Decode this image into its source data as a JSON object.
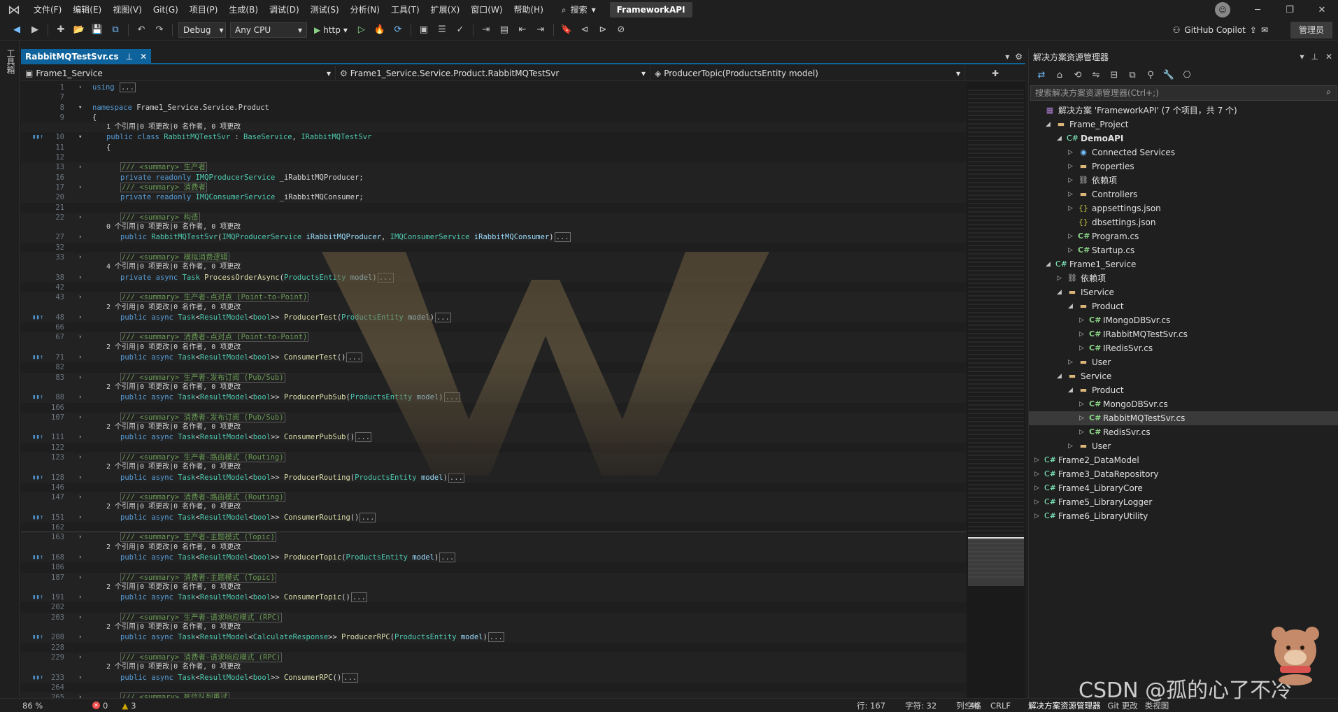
{
  "menubar": {
    "items": [
      "文件(F)",
      "编辑(E)",
      "视图(V)",
      "Git(G)",
      "项目(P)",
      "生成(B)",
      "调试(D)",
      "测试(S)",
      "分析(N)",
      "工具(T)",
      "扩展(X)",
      "窗口(W)",
      "帮助(H)"
    ],
    "search_label": "搜索",
    "solution_name": "FrameworkAPI"
  },
  "toolbar": {
    "config": "Debug",
    "platform": "Any CPU",
    "run_target": "http",
    "copilot": "GitHub Copilot",
    "admin": "管理员"
  },
  "toolbox": {
    "label": "工具箱"
  },
  "editor": {
    "tab_name": "RabbitMQTestSvr.cs",
    "nav_project": "Frame1_Service",
    "nav_class": "Frame1_Service.Service.Product.RabbitMQTestSvr",
    "nav_member": "ProducerTopic(ProductsEntity model)"
  },
  "code": {
    "lines": [
      {
        "ln": "1",
        "kind": "using",
        "text": "using"
      },
      {
        "ln": "7",
        "kind": "blank"
      },
      {
        "ln": "8",
        "kind": "namespace",
        "text": "namespace Frame1_Service.Service.Product"
      },
      {
        "ln": "9",
        "kind": "plain",
        "text": "{"
      },
      {
        "kind": "lens",
        "text": "1 个引用|0 项更改|0 名作者, 0 项更改"
      },
      {
        "ln": "10",
        "kind": "classdecl",
        "text": "public class RabbitMQTestSvr : BaseService, IRabbitMQTestSvr"
      },
      {
        "ln": "11",
        "kind": "plain",
        "text": "{"
      },
      {
        "ln": "12",
        "kind": "blank"
      },
      {
        "ln": "13",
        "kind": "summary",
        "text": "/// <summary> 生产者"
      },
      {
        "ln": "16",
        "kind": "field",
        "text": "private readonly IMQProducerService _iRabbitMQProducer;"
      },
      {
        "ln": "17",
        "kind": "summary",
        "text": "/// <summary> 消费者"
      },
      {
        "ln": "20",
        "kind": "field",
        "text": "private readonly IMQConsumerService _iRabbitMQConsumer;"
      },
      {
        "ln": "21",
        "kind": "blank"
      },
      {
        "ln": "22",
        "kind": "summary",
        "text": "/// <summary> 构造"
      },
      {
        "kind": "lens",
        "text": "0 个引用|0 项更改|0 名作者, 0 项更改"
      },
      {
        "ln": "27",
        "kind": "ctor",
        "text": "public RabbitMQTestSvr(IMQProducerService iRabbitMQProducer, IMQConsumerService iRabbitMQConsumer)"
      },
      {
        "ln": "32",
        "kind": "blank"
      },
      {
        "ln": "33",
        "kind": "summary",
        "text": "/// <summary> 模拟消费逻辑"
      },
      {
        "kind": "lens",
        "text": "4 个引用|0 项更改|0 名作者, 0 项更改"
      },
      {
        "ln": "38",
        "kind": "method",
        "text": "private async Task ProcessOrderAsync(ProductsEntity model)"
      },
      {
        "ln": "42",
        "kind": "blank"
      },
      {
        "ln": "43",
        "kind": "summary",
        "text": "/// <summary> 生产者-点对点 (Point-to-Point)"
      },
      {
        "kind": "lens",
        "text": "2 个引用|0 项更改|0 名作者, 0 项更改"
      },
      {
        "ln": "48",
        "kind": "method",
        "text": "public async Task<ResultModel<bool>> ProducerTest(ProductsEntity model)"
      },
      {
        "ln": "66",
        "kind": "blank"
      },
      {
        "ln": "67",
        "kind": "summary",
        "text": "/// <summary> 消费者-点对点 (Point-to-Point)"
      },
      {
        "kind": "lens",
        "text": "2 个引用|0 项更改|0 名作者, 0 项更改"
      },
      {
        "ln": "71",
        "kind": "method",
        "text": "public async Task<ResultModel<bool>> ConsumerTest()"
      },
      {
        "ln": "82",
        "kind": "blank"
      },
      {
        "ln": "83",
        "kind": "summary",
        "text": "/// <summary> 生产者-发布订阅 (Pub/Sub)"
      },
      {
        "kind": "lens",
        "text": "2 个引用|0 项更改|0 名作者, 0 项更改"
      },
      {
        "ln": "88",
        "kind": "method",
        "text": "public async Task<ResultModel<bool>> ProducerPubSub(ProductsEntity model)"
      },
      {
        "ln": "106",
        "kind": "blank"
      },
      {
        "ln": "107",
        "kind": "summary",
        "text": "/// <summary> 消费者-发布订阅 (Pub/Sub)"
      },
      {
        "kind": "lens",
        "text": "2 个引用|0 项更改|0 名作者, 0 项更改"
      },
      {
        "ln": "111",
        "kind": "method",
        "text": "public async Task<ResultModel<bool>> ConsumerPubSub()"
      },
      {
        "ln": "122",
        "kind": "blank"
      },
      {
        "ln": "123",
        "kind": "summary",
        "text": "/// <summary> 生产者-路由模式 (Routing)"
      },
      {
        "kind": "lens",
        "text": "2 个引用|0 项更改|0 名作者, 0 项更改"
      },
      {
        "ln": "128",
        "kind": "method",
        "text": "public async Task<ResultModel<bool>> ProducerRouting(ProductsEntity model)"
      },
      {
        "ln": "146",
        "kind": "blank"
      },
      {
        "ln": "147",
        "kind": "summary",
        "text": "/// <summary> 消费者-路由模式 (Routing)"
      },
      {
        "kind": "lens",
        "text": "2 个引用|0 项更改|0 名作者, 0 项更改"
      },
      {
        "ln": "151",
        "kind": "method",
        "text": "public async Task<ResultModel<bool>> ConsumerRouting()"
      },
      {
        "ln": "162",
        "kind": "blank"
      },
      {
        "ln": "163",
        "kind": "summary",
        "text": "/// <summary> 生产者-主题模式 (Topic)",
        "current": true
      },
      {
        "kind": "lens",
        "text": "2 个引用|0 项更改|0 名作者, 0 项更改"
      },
      {
        "ln": "168",
        "kind": "method",
        "text": "public async Task<ResultModel<bool>> ProducerTopic(ProductsEntity model)"
      },
      {
        "ln": "186",
        "kind": "blank"
      },
      {
        "ln": "187",
        "kind": "summary",
        "text": "/// <summary> 消费者-主题模式 (Topic)"
      },
      {
        "kind": "lens",
        "text": "2 个引用|0 项更改|0 名作者, 0 项更改"
      },
      {
        "ln": "191",
        "kind": "method",
        "text": "public async Task<ResultModel<bool>> ConsumerTopic()"
      },
      {
        "ln": "202",
        "kind": "blank"
      },
      {
        "ln": "203",
        "kind": "summary",
        "text": "/// <summary> 生产者-请求响应模式 (RPC)"
      },
      {
        "kind": "lens",
        "text": "2 个引用|0 项更改|0 名作者, 0 项更改"
      },
      {
        "ln": "208",
        "kind": "method",
        "text": "public async Task<ResultModel<CalculateResponse>> ProducerRPC(ProductsEntity model)"
      },
      {
        "ln": "228",
        "kind": "blank"
      },
      {
        "ln": "229",
        "kind": "summary",
        "text": "/// <summary> 消费者-请求响应模式 (RPC)"
      },
      {
        "kind": "lens",
        "text": "2 个引用|0 项更改|0 名作者, 0 项更改"
      },
      {
        "ln": "233",
        "kind": "method",
        "text": "public async Task<ResultModel<bool>> ConsumerRPC()"
      },
      {
        "ln": "264",
        "kind": "blank"
      },
      {
        "ln": "265",
        "kind": "summary",
        "text": "/// <summary> 死信队列重试"
      }
    ]
  },
  "statusbar": {
    "zoom": "86 %",
    "errors": "0",
    "warnings": "3",
    "line": "行: 167",
    "char": "字符: 32",
    "col": "列: 46",
    "indent": "空格",
    "eol": "CRLF",
    "bottom_tabs": [
      "解决方案资源管理器",
      "Git 更改",
      "类视图"
    ]
  },
  "solution_explorer": {
    "title": "解决方案资源管理器",
    "search_placeholder": "搜索解决方案资源管理器(Ctrl+;)",
    "tree": [
      {
        "label": "解决方案 'FrameworkAPI' (7 个项目，共 7 个)",
        "indent": 0,
        "arrow": "",
        "icon": "solution"
      },
      {
        "label": "Frame_Project",
        "indent": 1,
        "arrow": "open",
        "icon": "folder"
      },
      {
        "label": "DemoAPI",
        "indent": 2,
        "arrow": "open",
        "icon": "project",
        "bold": true
      },
      {
        "label": "Connected Services",
        "indent": 3,
        "arrow": "closed",
        "icon": "service"
      },
      {
        "label": "Properties",
        "indent": 3,
        "arrow": "closed",
        "icon": "folder"
      },
      {
        "label": "依赖项",
        "indent": 3,
        "arrow": "closed",
        "icon": "ref"
      },
      {
        "label": "Controllers",
        "indent": 3,
        "arrow": "closed",
        "icon": "folder"
      },
      {
        "label": "appsettings.json",
        "indent": 3,
        "arrow": "closed",
        "icon": "json"
      },
      {
        "label": "dbsettings.json",
        "indent": 3,
        "arrow": "",
        "icon": "json"
      },
      {
        "label": "Program.cs",
        "indent": 3,
        "arrow": "closed",
        "icon": "cs"
      },
      {
        "label": "Startup.cs",
        "indent": 3,
        "arrow": "closed",
        "icon": "cs"
      },
      {
        "label": "Frame1_Service",
        "indent": 1,
        "arrow": "open",
        "icon": "project"
      },
      {
        "label": "依赖项",
        "indent": 2,
        "arrow": "closed",
        "icon": "ref"
      },
      {
        "label": "IService",
        "indent": 2,
        "arrow": "open",
        "icon": "folder"
      },
      {
        "label": "Product",
        "indent": 3,
        "arrow": "open",
        "icon": "folder"
      },
      {
        "label": "IMongoDBSvr.cs",
        "indent": 4,
        "arrow": "closed",
        "icon": "cs"
      },
      {
        "label": "IRabbitMQTestSvr.cs",
        "indent": 4,
        "arrow": "closed",
        "icon": "cs"
      },
      {
        "label": "IRedisSvr.cs",
        "indent": 4,
        "arrow": "closed",
        "icon": "cs"
      },
      {
        "label": "User",
        "indent": 3,
        "arrow": "closed",
        "icon": "folder"
      },
      {
        "label": "Service",
        "indent": 2,
        "arrow": "open",
        "icon": "folder"
      },
      {
        "label": "Product",
        "indent": 3,
        "arrow": "open",
        "icon": "folder"
      },
      {
        "label": "MongoDBSvr.cs",
        "indent": 4,
        "arrow": "closed",
        "icon": "cs"
      },
      {
        "label": "RabbitMQTestSvr.cs",
        "indent": 4,
        "arrow": "closed",
        "icon": "cs",
        "selected": true
      },
      {
        "label": "RedisSvr.cs",
        "indent": 4,
        "arrow": "closed",
        "icon": "cs"
      },
      {
        "label": "User",
        "indent": 3,
        "arrow": "closed",
        "icon": "folder"
      },
      {
        "label": "Frame2_DataModel",
        "indent": 0,
        "arrow": "closed",
        "icon": "project"
      },
      {
        "label": "Frame3_DataRepository",
        "indent": 0,
        "arrow": "closed",
        "icon": "project"
      },
      {
        "label": "Frame4_LibraryCore",
        "indent": 0,
        "arrow": "closed",
        "icon": "project"
      },
      {
        "label": "Frame5_LibraryLogger",
        "indent": 0,
        "arrow": "closed",
        "icon": "project"
      },
      {
        "label": "Frame6_LibraryUtility",
        "indent": 0,
        "arrow": "closed",
        "icon": "project"
      }
    ]
  },
  "watermark": {
    "text": "CSDN @孤的心了不冷"
  }
}
